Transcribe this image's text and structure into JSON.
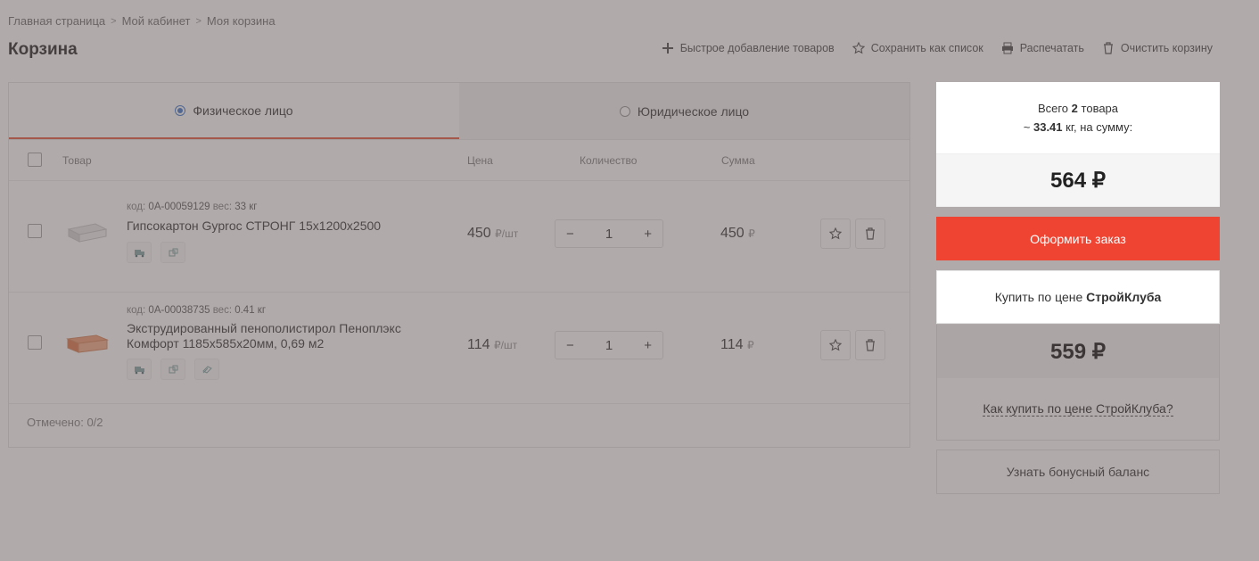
{
  "breadcrumb": [
    "Главная страница",
    "Мой кабинет",
    "Моя корзина"
  ],
  "page_title": "Корзина",
  "actions": {
    "quick_add": "Быстрое добавление товаров",
    "save_list": "Сохранить как список",
    "print": "Распечатать",
    "clear": "Очистить корзину"
  },
  "tabs": {
    "individual": "Физическое лицо",
    "legal": "Юридическое лицо"
  },
  "table_headers": {
    "product": "Товар",
    "price": "Цена",
    "quantity": "Количество",
    "sum": "Сумма"
  },
  "items": [
    {
      "code_label": "код:",
      "code": "0А-00059129",
      "weight_label": "вес:",
      "weight": "33 кг",
      "name": "Гипсокартон Gyproc СТРОНГ 15х1200х2500",
      "price": "450",
      "price_unit": "₽/шт",
      "qty": "1",
      "sum": "450",
      "currency": "₽"
    },
    {
      "code_label": "код:",
      "code": "0А-00038735",
      "weight_label": "вес:",
      "weight": "0.41 кг",
      "name": "Экструдированный пенополистирол Пеноплэкс Комфорт 1185х585х20мм, 0,69 м2",
      "price": "114",
      "price_unit": "₽/шт",
      "qty": "1",
      "sum": "114",
      "currency": "₽"
    }
  ],
  "qty_minus": "−",
  "qty_plus": "+",
  "selected": {
    "label": "Отмечено:",
    "value": "0/2"
  },
  "summary": {
    "total_prefix": "Всего",
    "total_count": "2",
    "total_suffix": "товара",
    "weight_prefix": "~",
    "weight": "33.41",
    "weight_suffix": "кг, на сумму:",
    "total": "564 ₽",
    "order_button": "Оформить заказ",
    "club_button_prefix": "Купить по цене",
    "club_button_brand": "СтройКлуба",
    "club_price": "559 ₽",
    "club_how": "Как купить по цене СтройКлуба?",
    "bonus_button": "Узнать бонусный баланс"
  },
  "colors": {
    "accent_red": "#f04433",
    "radio_blue": "#4a7fd0",
    "tab_underline": "#e8604a",
    "overlay": "rgba(90,78,78,0.48)"
  }
}
